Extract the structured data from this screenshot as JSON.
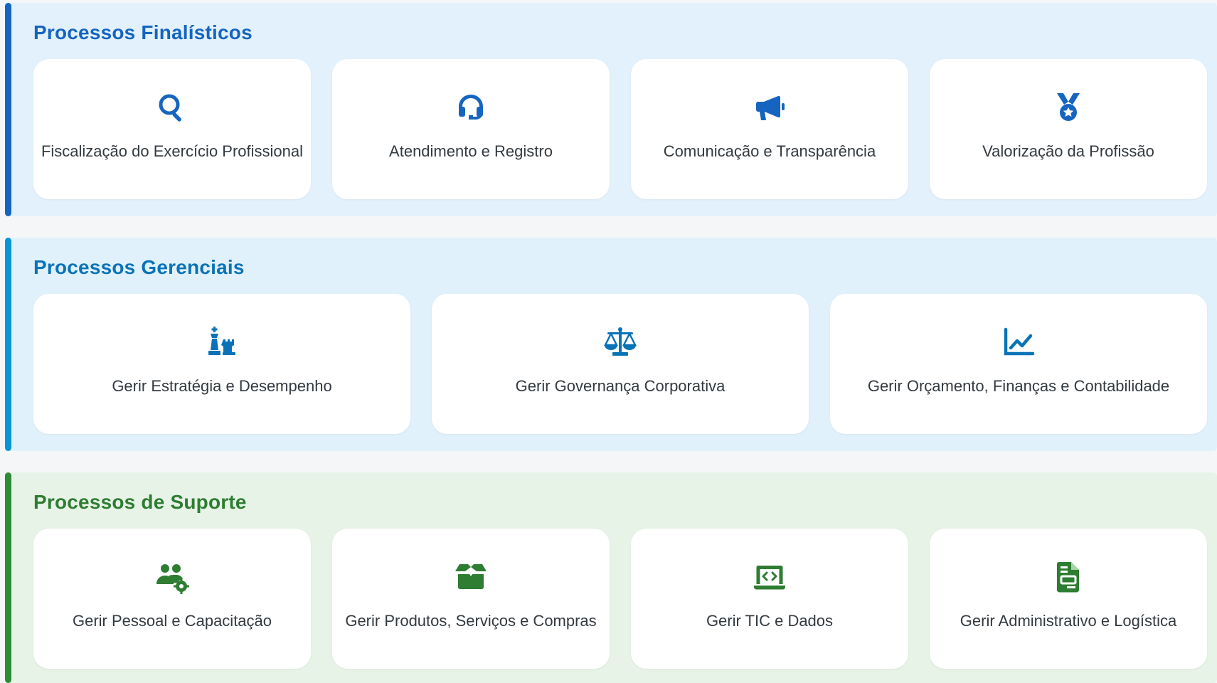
{
  "sections": [
    {
      "title": "Processos Finalísticos",
      "color": "#1565c0",
      "background": "#e3f1fc",
      "cards": [
        {
          "label": "Fiscalização do Exercício Profissional",
          "icon": "search-icon"
        },
        {
          "label": "Atendimento e Registro",
          "icon": "headset-icon"
        },
        {
          "label": "Comunicação e Transparência",
          "icon": "megaphone-icon"
        },
        {
          "label": "Valorização da Profissão",
          "icon": "medal-icon"
        }
      ]
    },
    {
      "title": "Processos Gerenciais",
      "color": "#0a73b8",
      "background": "#e1f1fb",
      "cards": [
        {
          "label": "Gerir Estratégia e Desempenho",
          "icon": "chess-icon"
        },
        {
          "label": "Gerir Governança Corporativa",
          "icon": "scale-icon"
        },
        {
          "label": "Gerir Orçamento, Finanças e Contabilidade",
          "icon": "line-chart-icon"
        }
      ]
    },
    {
      "title": "Processos de Suporte",
      "color": "#2e7d32",
      "background": "#e7f3e7",
      "cards": [
        {
          "label": "Gerir Pessoal e Capacitação",
          "icon": "users-gear-icon"
        },
        {
          "label": "Gerir Produtos, Serviços e Compras",
          "icon": "box-open-icon"
        },
        {
          "label": "Gerir TIC e Dados",
          "icon": "laptop-code-icon"
        },
        {
          "label": "Gerir Administrativo e Logística",
          "icon": "file-invoice-icon"
        }
      ]
    }
  ]
}
